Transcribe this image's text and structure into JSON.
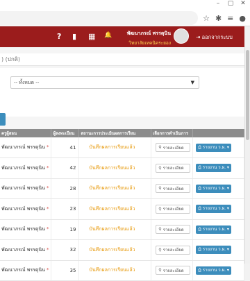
{
  "browser": {
    "win_min": "–",
    "win_max": "▢",
    "win_close": "✕",
    "toolbar_icons": [
      "☆",
      "✱",
      "≡",
      "●"
    ]
  },
  "navbar": {
    "icons": [
      "?",
      "▮",
      "▦",
      "🔔"
    ],
    "user_name": "พัฒนาภรณ์ พรรดุนิน",
    "school": "วิทยาลัยเทคนิคระยอง",
    "logout": "ออกจากระบบ"
  },
  "page": {
    "header_text": ") (ปกติ)",
    "select_value": "-- ทั้งหมด --"
  },
  "table": {
    "headers": [
      "ครูผู้สอน",
      "ผู้ลงทะเบียน",
      "สถานะการประเมินผลการเรียน",
      "เลือกการดำเนินการ",
      ""
    ],
    "rows": [
      {
        "name": "พัฒนาภรณ์ พรรดุนิน",
        "count": "41",
        "status": "บันทึกผลการเรียนแล้ว",
        "detail": "รายละเอียด",
        "report": "รายงาน ว.ผ."
      },
      {
        "name": "พัฒนาภรณ์ พรรดุนิน",
        "count": "42",
        "status": "บันทึกผลการเรียนแล้ว",
        "detail": "รายละเอียด",
        "report": "รายงาน ว.ผ."
      },
      {
        "name": "พัฒนาภรณ์ พรรดุนิน",
        "count": "28",
        "status": "บันทึกผลการเรียนแล้ว",
        "detail": "รายละเอียด",
        "report": "รายงาน ว.ผ."
      },
      {
        "name": "พัฒนาภรณ์ พรรดุนิน",
        "count": "23",
        "status": "บันทึกผลการเรียนแล้ว",
        "detail": "รายละเอียด",
        "report": "รายงาน ว.ผ."
      },
      {
        "name": "พัฒนาภรณ์ พรรดุนิน",
        "count": "19",
        "status": "บันทึกผลการเรียนแล้ว",
        "detail": "รายละเอียด",
        "report": "รายงาน ว.ผ."
      },
      {
        "name": "พัฒนาภรณ์ พรรดุนิน",
        "count": "32",
        "status": "บันทึกผลการเรียนแล้ว",
        "detail": "รายละเอียด",
        "report": "รายงาน ว.ผ."
      },
      {
        "name": "พัฒนาภรณ์ พรรดุนิน",
        "count": "35",
        "status": "บันทึกผลการเรียนแล้ว",
        "detail": "รายละเอียด",
        "report": "รายงาน ว.ผ."
      }
    ]
  }
}
